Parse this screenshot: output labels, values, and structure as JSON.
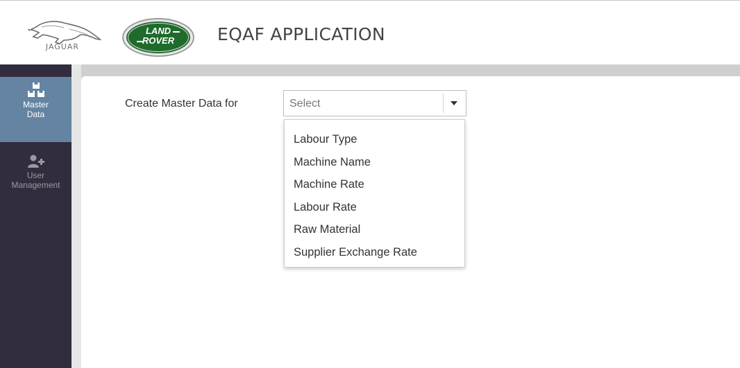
{
  "header": {
    "jaguar_logo_text": "JAGUAR",
    "land_rover_line1": "LAND",
    "land_rover_line2": "ROVER",
    "app_title": "EQAF APPLICATION"
  },
  "sidebar": {
    "items": [
      {
        "label_line1": "Master",
        "label_line2": "Data",
        "icon": "cubes-icon",
        "active": true
      },
      {
        "label_line1": "User",
        "label_line2": "Management",
        "icon": "user-add-icon",
        "active": false
      }
    ]
  },
  "form": {
    "label": "Create Master Data for",
    "select": {
      "value": "Select",
      "options": [
        "Labour Type",
        "Machine Name",
        "Machine Rate",
        "Labour Rate",
        "Raw Material",
        "Supplier Exchange Rate"
      ]
    }
  },
  "colors": {
    "sidebar_bg": "#322d3e",
    "sidebar_active": "#6484a2",
    "land_rover_green": "#1f6b2c"
  }
}
